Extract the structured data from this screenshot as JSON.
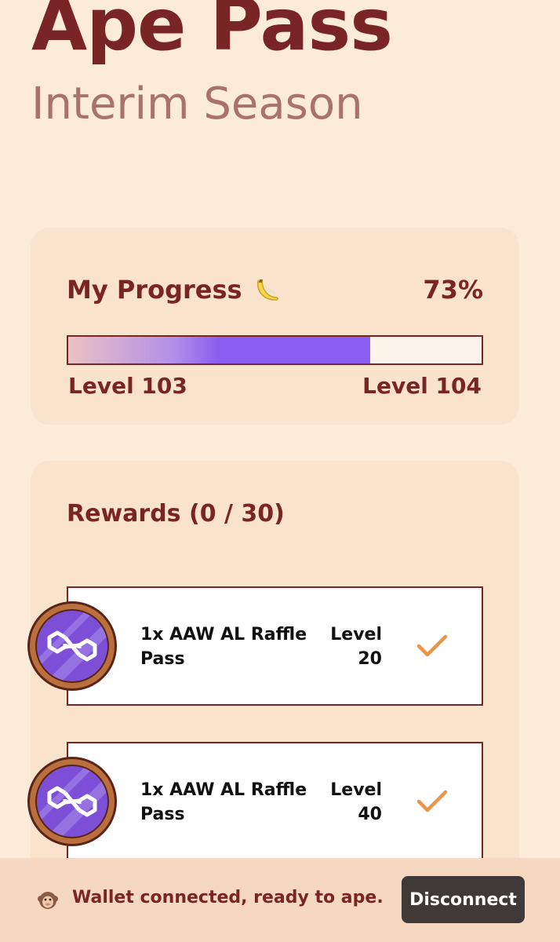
{
  "header": {
    "title": "Ape Pass",
    "subtitle": "Interim Season"
  },
  "progress": {
    "label": "My Progress",
    "icon": "banana-icon",
    "percent_text": "73%",
    "percent_value": 73,
    "level_from": "Level 103",
    "level_to": "Level 104"
  },
  "rewards": {
    "title": "Rewards (0 / 30)",
    "items": [
      {
        "name": "1x AAW AL Raffle Pass",
        "level_label": "Level",
        "level_value": "20",
        "icon": "polygon-icon",
        "status_icon": "check-icon"
      },
      {
        "name": "1x AAW AL Raffle Pass",
        "level_label": "Level",
        "level_value": "40",
        "icon": "polygon-icon",
        "status_icon": "check-icon"
      }
    ]
  },
  "footer": {
    "icon": "ape-icon",
    "status": "Wallet connected, ready to ape.",
    "disconnect_label": "Disconnect"
  },
  "colors": {
    "background": "#fcebd8",
    "card": "#f9e3cc",
    "brand_dark": "#7a2525",
    "accent_purple": "#8b5cf0",
    "check_orange": "#e8964a",
    "button_dark": "#3f3a37"
  }
}
